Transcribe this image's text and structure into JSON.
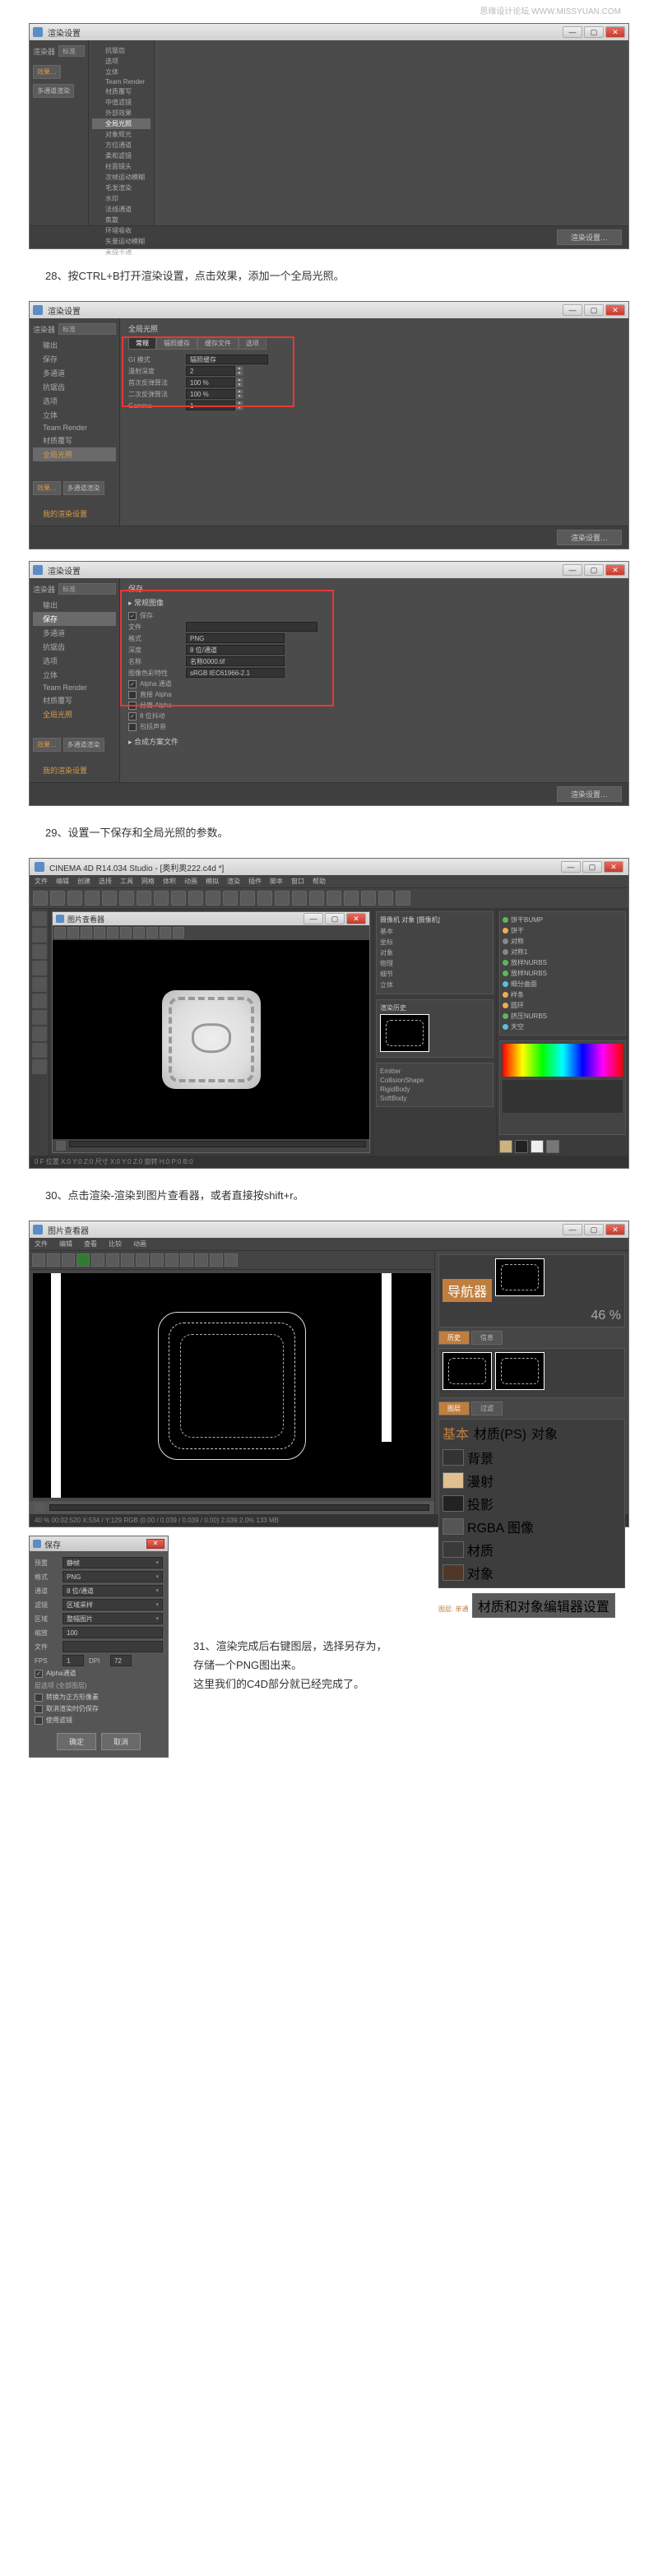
{
  "watermark": "思缘设计论坛   WWW.MISSYUAN.COM",
  "captions": {
    "c28": "28、按CTRL+B打开渲染设置，点击效果，添加一个全局光照。",
    "c29": "29、设置一下保存和全局光照的参数。",
    "c30": "30、点击渲染-渲染到图片查看器，或者直接按shift+r。"
  },
  "win_common": {
    "render_title": "渲染设置",
    "render_btn": "渲染设置…"
  },
  "shot1": {
    "sidebar_toggle": "渲染器",
    "sidebar_sel": "标准",
    "effects": "效果…",
    "multi": "多通道渲染",
    "tree": [
      "抗锯齿",
      "选项",
      "立体",
      "Team Render",
      "材质覆写",
      "中值滤镜",
      "外部效果",
      "全局光照",
      "对象辉光",
      "方位通道",
      "柔和滤镜",
      "柱面镜头",
      "次帧运动模糊",
      "毛发渲染",
      "水印",
      "法线通道",
      "焦散",
      "环境吸收",
      "矢量运动模糊",
      "素描卡通"
    ],
    "tree_selected": "全局光照"
  },
  "shot2": {
    "top_title": "全局光照",
    "tabs": [
      "常规",
      "辐照缓存",
      "缓存文件",
      "选项"
    ],
    "rows": [
      {
        "lbl": "GI 模式",
        "val": "辐照缓存"
      },
      {
        "lbl": "漫射深度",
        "val": "2"
      },
      {
        "lbl": "首次反弹算法",
        "val": "100 %"
      },
      {
        "lbl": "二次反弹算法",
        "val": "100 %"
      },
      {
        "lbl": "Gamma",
        "val": "1"
      }
    ],
    "sidebar_items": [
      "输出",
      "保存",
      "多通道",
      "抗锯齿",
      "选项",
      "立体",
      "Team Render",
      "材质覆写",
      "全局光照"
    ],
    "sidebar_sel_item": "全局光照",
    "effects": "效果…",
    "multi": "多通道渲染",
    "my_render": "我的渲染设置"
  },
  "shot3": {
    "save_title": "保存",
    "section": "▸ 常规图像",
    "rows": [
      {
        "lbl": "保存",
        "check": true
      },
      {
        "lbl": "文件",
        "val": ""
      },
      {
        "lbl": "格式",
        "val": "PNG"
      },
      {
        "lbl": "深度",
        "val": "8 位/通道"
      },
      {
        "lbl": "名称",
        "val": "名称0000.tif"
      },
      {
        "lbl": "图像色彩特性",
        "val": "sRGB IEC61966-2.1"
      },
      {
        "lbl": "Alpha 通道",
        "check": true
      },
      {
        "lbl": "直接 Alpha",
        "check": false
      },
      {
        "lbl": "分离 Alpha",
        "check": false
      },
      {
        "lbl": "8 位抖动",
        "check": true
      },
      {
        "lbl": "包括声音",
        "check": false
      }
    ],
    "section2": "▸ 合成方案文件",
    "sidebar_items": [
      "输出",
      "保存",
      "多通道",
      "抗锯齿",
      "选项",
      "立体",
      "Team Render",
      "材质覆写",
      "全局光照"
    ],
    "sidebar_sel_item": "保存"
  },
  "c4d": {
    "title": "CINEMA 4D R14.034 Studio - [奥利奥222.c4d *]",
    "menu": [
      "文件",
      "编辑",
      "创建",
      "选择",
      "工具",
      "网格",
      "体积",
      "动画",
      "模拟",
      "渲染",
      "插件",
      "脚本",
      "窗口",
      "帮助"
    ],
    "viewer_title": "图片查看器",
    "objects": [
      {
        "name": "饼干BUMP",
        "c": "g"
      },
      {
        "name": "饼干",
        "c": "y"
      },
      {
        "name": "对称",
        "c": "gray"
      },
      {
        "name": "对称1",
        "c": "gray"
      },
      {
        "name": "放样NURBS",
        "c": "g"
      },
      {
        "name": "放样NURBS",
        "c": "g"
      },
      {
        "name": "细分曲面",
        "c": "b"
      },
      {
        "name": "样条",
        "c": "y"
      },
      {
        "name": "圆环",
        "c": "y"
      },
      {
        "name": "挤压NURBS",
        "c": "g"
      },
      {
        "name": "天空",
        "c": "b"
      }
    ],
    "mid1": {
      "title": "摄像机 对象 [摄像机]",
      "rows": [
        "基本",
        "坐标",
        "对象",
        "物理",
        "细节",
        "立体"
      ]
    },
    "mid2_rows": [
      "Emitter",
      "CollisionShape",
      "RigidBody",
      "SoftBody"
    ],
    "thumbs_label": "渲染历史",
    "status": "0 F   位置 X:0 Y:0 Z:0  尺寸 X:0 Y:0 Z:0  旋转 H:0 P:0 B:0"
  },
  "pv": {
    "title": "图片查看器",
    "navigator": "导航器",
    "history": "历史",
    "info": "信息",
    "filter": "过滤",
    "layers_title": "图层",
    "layers_tabs": [
      "基本",
      "材质(PS)",
      "对象"
    ],
    "layers": [
      {
        "name": "背景",
        "c": "#333"
      },
      {
        "name": "漫射",
        "c": "#e0c090"
      },
      {
        "name": "投影",
        "c": "#222"
      },
      {
        "name": "RGBA 图像",
        "c": "#555"
      },
      {
        "name": "材质",
        "c": "#3a3a3a"
      },
      {
        "name": "对象",
        "c": "#503828"
      }
    ],
    "extra": "材质和对象编辑器设置",
    "pct": "46 %",
    "status": "40 %   00:02:520   X:534 / Y:129   RGB (0.00 / 0.039 / 0.039 / 0.00)   2.039   2.0%     133 MB",
    "single": "图层: 单通"
  },
  "save": {
    "title": "保存",
    "preset_lbl": "预置",
    "preset_val": "静帧",
    "rows": [
      {
        "lbl": "格式",
        "val": "PNG"
      },
      {
        "lbl": "通道",
        "val": "8 位/通道"
      },
      {
        "lbl": "滤镜",
        "val": "区域采样"
      },
      {
        "lbl": "区域",
        "val": "整幅图片"
      },
      {
        "lbl": "缩放",
        "val": "100"
      },
      {
        "lbl": "文件",
        "val": ""
      }
    ],
    "fps": "FPS",
    "fps_v": "1",
    "dpi": "DPI",
    "dpi_v": "72",
    "alpha": "Alpha通道",
    "opts": [
      "层选项 (全部图层)",
      "转换为正方形像素",
      "取消渲染时仍保存",
      "使用滤镜"
    ],
    "ok": "确定",
    "cancel": "取消"
  },
  "save_text": {
    "l1": "31、渲染完成后右键图层，选择另存为，",
    "l2": "存储一个PNG图出来。",
    "l3": "这里我们的C4D部分就已经完成了。"
  }
}
